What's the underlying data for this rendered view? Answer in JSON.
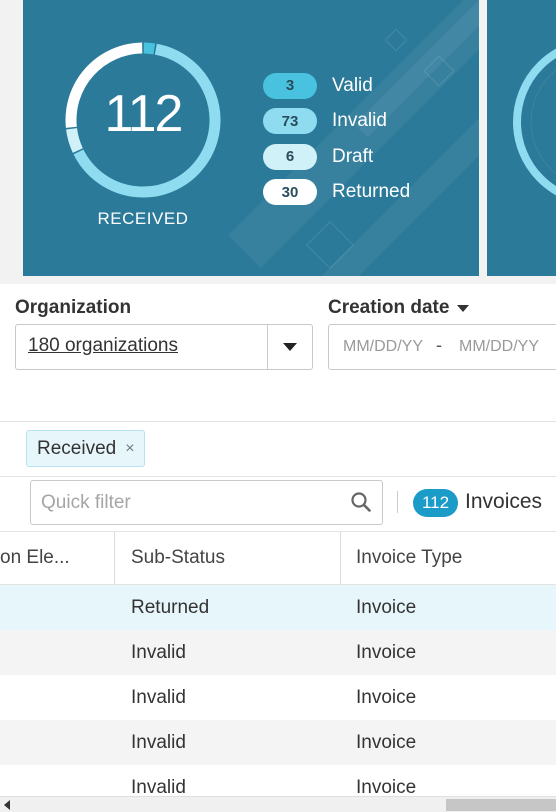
{
  "summary": {
    "total": "112",
    "caption": "RECEIVED",
    "segments": [
      {
        "key": "valid",
        "count": 3,
        "color": "#49c2e0"
      },
      {
        "key": "invalid",
        "count": 73,
        "color": "#8fdcf0"
      },
      {
        "key": "draft",
        "count": 6,
        "color": "#d1f1f9"
      },
      {
        "key": "returned",
        "count": 30,
        "color": "#ffffff"
      }
    ],
    "legend": [
      {
        "count": "3",
        "label": "Valid",
        "color": "#49c2e0"
      },
      {
        "count": "73",
        "label": "Invalid",
        "color": "#8fdcf0"
      },
      {
        "count": "6",
        "label": "Draft",
        "color": "#d1f1f9"
      },
      {
        "count": "30",
        "label": "Returned",
        "color": "#ffffff"
      }
    ]
  },
  "filters": {
    "organization": {
      "label": "Organization",
      "value": "180 organizations"
    },
    "creation_date": {
      "label": "Creation date",
      "from_placeholder": "MM/DD/YY",
      "to_placeholder": "MM/DD/YY",
      "separator": "-"
    },
    "active_chips": [
      "Received"
    ],
    "chip_close": "×"
  },
  "toolbar": {
    "quick_filter_placeholder": "Quick filter",
    "count": "112",
    "count_label": "Invoices"
  },
  "grid": {
    "columns": [
      "on Ele...",
      "Sub-Status",
      "Invoice Type"
    ],
    "rows": [
      {
        "sub_status": "Returned",
        "invoice_type": "Invoice"
      },
      {
        "sub_status": "Invalid",
        "invoice_type": "Invoice"
      },
      {
        "sub_status": "Invalid",
        "invoice_type": "Invoice"
      },
      {
        "sub_status": "Invalid",
        "invoice_type": "Invoice"
      },
      {
        "sub_status": "Invalid",
        "invoice_type": "Invoice"
      }
    ]
  },
  "colors": {
    "card_bg": "#2b7a99",
    "accent": "#1a9bc8",
    "selected_row": "#e6f6fb"
  },
  "icons": {
    "search": "search-icon",
    "dropdown": "caret-down-icon",
    "close": "close-icon",
    "scroll_left": "scroll-left-arrow-icon"
  }
}
